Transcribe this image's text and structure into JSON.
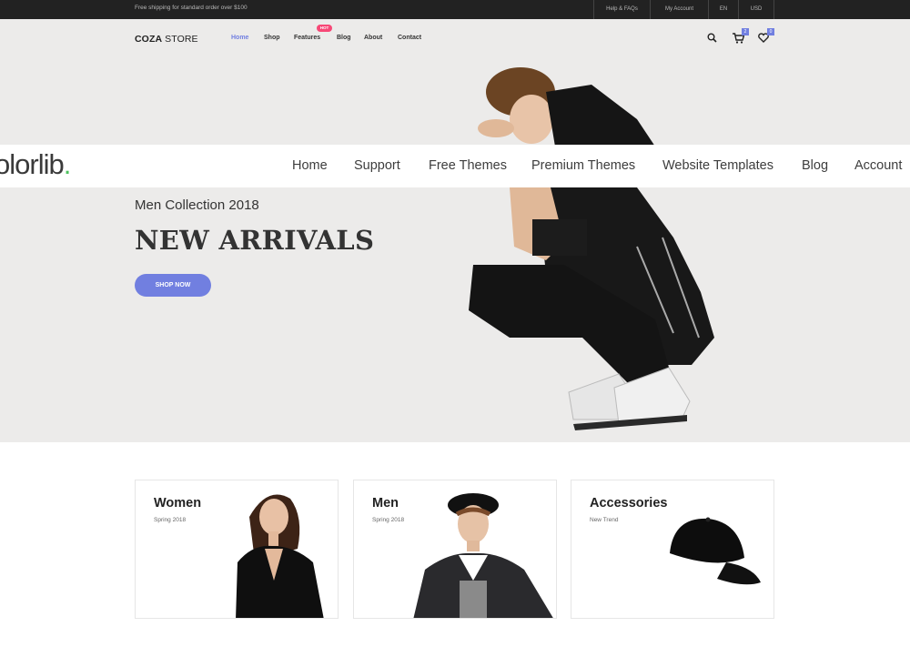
{
  "topbar": {
    "shipping_text": "Free shipping for standard order over $100",
    "links": [
      "Help & FAQs",
      "My Account",
      "EN",
      "USD"
    ]
  },
  "header": {
    "logo_bold": "COZA",
    "logo_rest": " STORE",
    "nav": [
      "Home",
      "Shop",
      "Features",
      "Blog",
      "About",
      "Contact"
    ],
    "active_nav": "Home",
    "hot_badge": "HOT",
    "cart_count": "2",
    "wishlist_count": "0"
  },
  "colorlib": {
    "logo_text": "olorlib",
    "logo_dot": ".",
    "nav": [
      "Home",
      "Support",
      "Free Themes",
      "Premium Themes",
      "Website Templates",
      "Blog",
      "Account"
    ]
  },
  "hero": {
    "subtitle": "Men Collection 2018",
    "title": "NEW ARRIVALS",
    "button": "SHOP NOW"
  },
  "categories": [
    {
      "title": "Women",
      "subtitle": "Spring 2018"
    },
    {
      "title": "Men",
      "subtitle": "Spring 2018"
    },
    {
      "title": "Accessories",
      "subtitle": "New Trend"
    }
  ],
  "colors": {
    "accent": "#717fe0",
    "hot": "#f74877",
    "colorlib_dot": "#4ec25e",
    "topbar": "#222222",
    "hero_bg": "#ecebea"
  },
  "icons": [
    "search-icon",
    "cart-icon",
    "heart-icon"
  ]
}
